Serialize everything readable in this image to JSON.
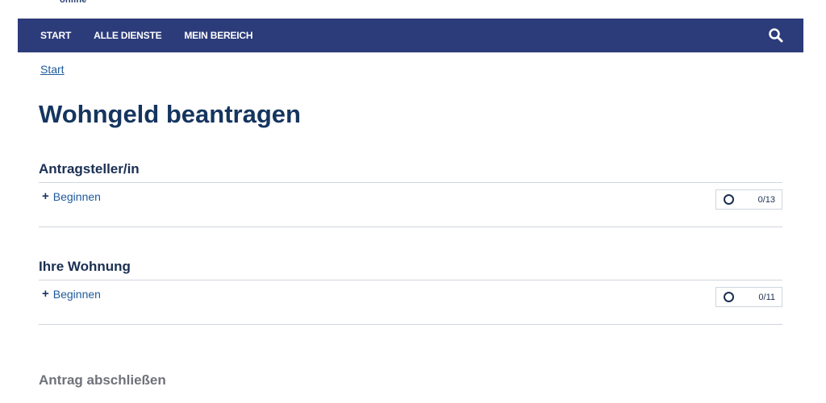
{
  "logo": {
    "text": "online"
  },
  "nav": {
    "items": [
      {
        "label": "START"
      },
      {
        "label": "ALLE DIENSTE"
      },
      {
        "label": "MEIN BEREICH"
      }
    ],
    "search_icon": "search-icon",
    "background_color": "#2c3b7a"
  },
  "breadcrumb": {
    "start": "Start"
  },
  "page": {
    "title": "Wohngeld beantragen"
  },
  "sections": [
    {
      "title": "Antragsteller/in",
      "action_label": "Beginnen",
      "action_icon": "plus-icon",
      "status_icon": "circle-status-icon",
      "progress": "0/13"
    },
    {
      "title": "Ihre Wohnung",
      "action_label": "Beginnen",
      "action_icon": "plus-icon",
      "status_icon": "circle-status-icon",
      "progress": "0/11"
    }
  ],
  "final_section": {
    "title": "Antrag abschließen"
  },
  "colors": {
    "title": "#15355f",
    "link": "#1d5a9c",
    "muted": "#6f7279"
  }
}
